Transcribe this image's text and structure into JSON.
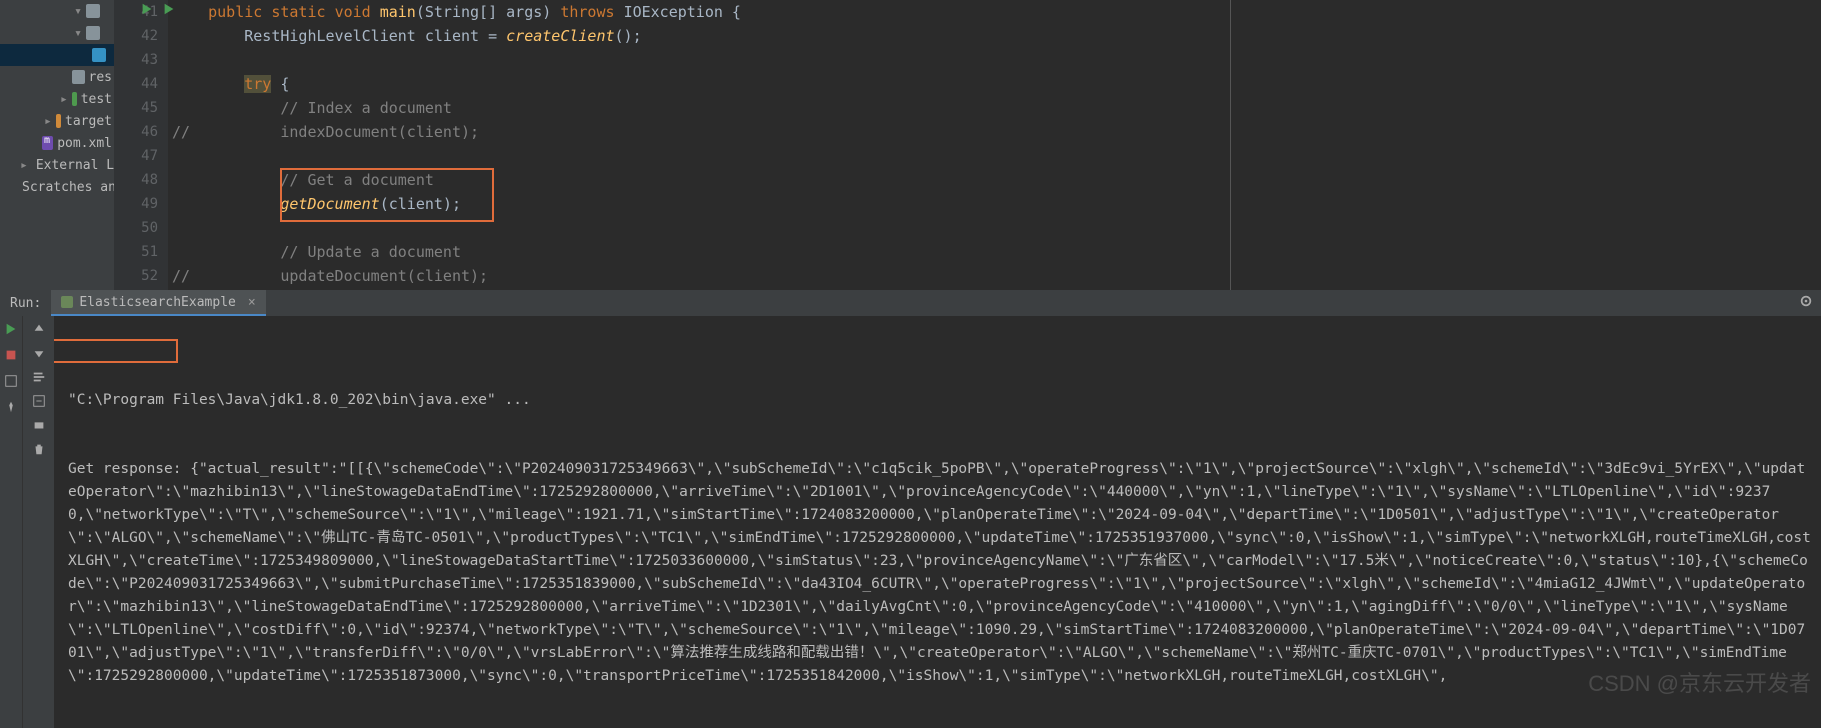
{
  "project_tree": {
    "rows": [
      {
        "name": "",
        "icon": "folder-icon",
        "chevron": "down",
        "indent": 72
      },
      {
        "name": "",
        "icon": "folder-icon",
        "chevron": "down",
        "indent": 72
      },
      {
        "name": "",
        "icon": "folder-blue",
        "chevron": null,
        "indent": 92,
        "highlight": true
      },
      {
        "name": "res",
        "icon": "folder-icon",
        "chevron": null,
        "indent": 72
      },
      {
        "name": "test",
        "icon": "folder-green",
        "chevron": "right",
        "indent": 58
      },
      {
        "name": "target",
        "icon": "folder-orange",
        "chevron": "right",
        "indent": 42
      },
      {
        "name": "pom.xml",
        "icon": "file-m",
        "chevron": null,
        "indent": 42
      },
      {
        "name": "External Libr",
        "icon": "lib-icon",
        "chevron": "right",
        "indent": 18
      },
      {
        "name": "Scratches an",
        "icon": "scratch-icon",
        "chevron": null,
        "indent": 18
      }
    ]
  },
  "line_numbers": [
    "41",
    "42",
    "43",
    "44",
    "45",
    "46",
    "47",
    "48",
    "49",
    "50",
    "51",
    "52"
  ],
  "code": {
    "l41": {
      "pre": "    ",
      "kw1": "public",
      "sp1": " ",
      "kw2": "static",
      "sp2": " ",
      "kw3": "void",
      "sp3": " ",
      "mname": "main",
      "args": "(String[] args) ",
      "kw4": "throws",
      "sp4": " ",
      "exc": "IOException {",
      "all_keywords": ""
    },
    "l42": {
      "pre": "        ",
      "txt1": "RestHighLevelClient client = ",
      "call": "createClient",
      "tail": "();"
    },
    "l43": {
      "pre": ""
    },
    "l44": {
      "pre": "        ",
      "try": "try",
      "tail": " {"
    },
    "l45": {
      "pre": "            ",
      "com": "// Index a document"
    },
    "l46": {
      "pre": "//          ",
      "txt": "indexDocument(client);"
    },
    "l47": {
      "pre": ""
    },
    "l48": {
      "pre": "            ",
      "com": "// Get a document"
    },
    "l49": {
      "pre": "            ",
      "call": "getDocument",
      "tail": "(client);"
    },
    "l50": {
      "pre": ""
    },
    "l51": {
      "pre": "            ",
      "com": "// Update a document"
    },
    "l52": {
      "pre": "//          ",
      "txt": "updateDocument(client);"
    }
  },
  "run": {
    "label": "Run:",
    "tab": "ElasticsearchExample"
  },
  "console": {
    "line0": "\"C:\\Program Files\\Java\\jdk1.8.0_202\\bin\\java.exe\" ...",
    "response_label": "Get response: ",
    "body": "{\"actual_result\":\"[[{\\\"schemeCode\\\":\\\"P202409031725349663\\\",\\\"subSchemeId\\\":\\\"c1q5cik_5poPB\\\",\\\"operateProgress\\\":\\\"1\\\",\\\"projectSource\\\":\\\"xlgh\\\",\\\"schemeId\\\":\\\"3dEc9vi_5YrEX\\\",\\\"updateOperator\\\":\\\"mazhibin13\\\",\\\"lineStowageDataEndTime\\\":1725292800000,\\\"arriveTime\\\":\\\"2D1001\\\",\\\"provinceAgencyCode\\\":\\\"440000\\\",\\\"yn\\\":1,\\\"lineType\\\":\\\"1\\\",\\\"sysName\\\":\\\"LTLOpenline\\\",\\\"id\\\":92370,\\\"networkType\\\":\\\"T\\\",\\\"schemeSource\\\":\\\"1\\\",\\\"mileage\\\":1921.71,\\\"simStartTime\\\":1724083200000,\\\"planOperateTime\\\":\\\"2024-09-04\\\",\\\"departTime\\\":\\\"1D0501\\\",\\\"adjustType\\\":\\\"1\\\",\\\"createOperator\\\":\\\"ALGO\\\",\\\"schemeName\\\":\\\"佛山TC-青岛TC-0501\\\",\\\"productTypes\\\":\\\"TC1\\\",\\\"simEndTime\\\":1725292800000,\\\"updateTime\\\":1725351937000,\\\"sync\\\":0,\\\"isShow\\\":1,\\\"simType\\\":\\\"networkXLGH,routeTimeXLGH,costXLGH\\\",\\\"createTime\\\":1725349809000,\\\"lineStowageDataStartTime\\\":1725033600000,\\\"simStatus\\\":23,\\\"provinceAgencyName\\\":\\\"广东省区\\\",\\\"carModel\\\":\\\"17.5米\\\",\\\"noticeCreate\\\":0,\\\"status\\\":10},{\\\"schemeCode\\\":\\\"P202409031725349663\\\",\\\"submitPurchaseTime\\\":1725351839000,\\\"subSchemeId\\\":\\\"da43IO4_6CUTR\\\",\\\"operateProgress\\\":\\\"1\\\",\\\"projectSource\\\":\\\"xlgh\\\",\\\"schemeId\\\":\\\"4miaG12_4JWmt\\\",\\\"updateOperator\\\":\\\"mazhibin13\\\",\\\"lineStowageDataEndTime\\\":1725292800000,\\\"arriveTime\\\":\\\"1D2301\\\",\\\"dailyAvgCnt\\\":0,\\\"provinceAgencyCode\\\":\\\"410000\\\",\\\"yn\\\":1,\\\"agingDiff\\\":\\\"0/0\\\",\\\"lineType\\\":\\\"1\\\",\\\"sysName\\\":\\\"LTLOpenline\\\",\\\"costDiff\\\":0,\\\"id\\\":92374,\\\"networkType\\\":\\\"T\\\",\\\"schemeSource\\\":\\\"1\\\",\\\"mileage\\\":1090.29,\\\"simStartTime\\\":1724083200000,\\\"planOperateTime\\\":\\\"2024-09-04\\\",\\\"departTime\\\":\\\"1D0701\\\",\\\"adjustType\\\":\\\"1\\\",\\\"transferDiff\\\":\\\"0/0\\\",\\\"vrsLabError\\\":\\\"算法推荐生成线路和配载出错！\\\",\\\"createOperator\\\":\\\"ALGO\\\",\\\"schemeName\\\":\\\"郑州TC-重庆TC-0701\\\",\\\"productTypes\\\":\\\"TC1\\\",\\\"simEndTime\\\":1725292800000,\\\"updateTime\\\":1725351873000,\\\"sync\\\":0,\\\"transportPriceTime\\\":1725351842000,\\\"isShow\\\":1,\\\"simType\\\":\\\"networkXLGH,routeTimeXLGH,costXLGH\\\","
  },
  "watermark": "CSDN @京东云开发者"
}
